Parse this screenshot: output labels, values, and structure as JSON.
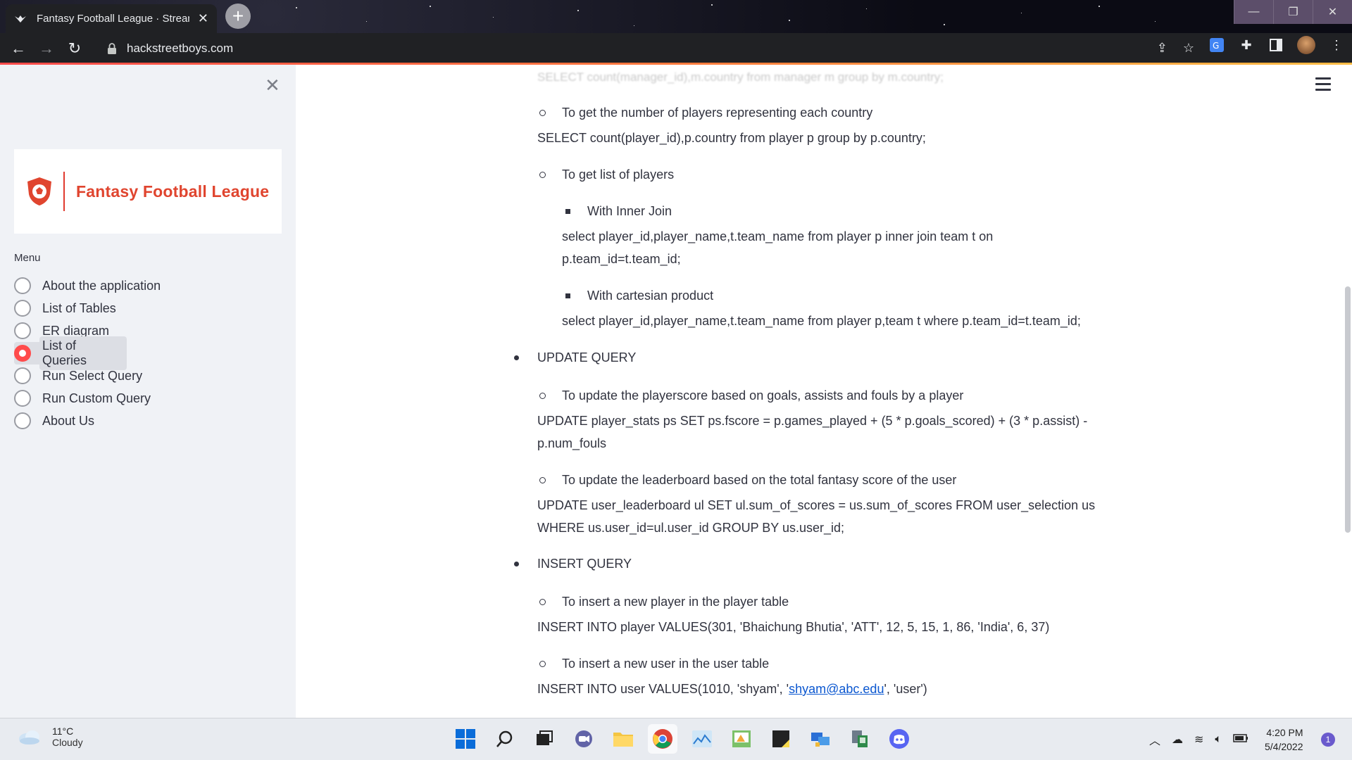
{
  "browser": {
    "tab_title": "Fantasy Football League · Stream",
    "tab_close": "✕",
    "new_tab": "+",
    "url": "hackstreetboys.com",
    "window_controls": {
      "minimize": "—",
      "restore": "❐",
      "close": "✕"
    }
  },
  "sidebar": {
    "close_symbol": "✕",
    "logo_text": "Fantasy Football League",
    "menu_label": "Menu",
    "items": [
      {
        "label": "About the application",
        "selected": false
      },
      {
        "label": "List of Tables",
        "selected": false
      },
      {
        "label": "ER diagram",
        "selected": false
      },
      {
        "label": "List of Queries",
        "selected": true
      },
      {
        "label": "Run Select Query",
        "selected": false
      },
      {
        "label": "Run Custom Query",
        "selected": false
      },
      {
        "label": "About Us",
        "selected": false
      }
    ]
  },
  "content": {
    "faded_top": "SELECT count(manager_id),m.country from manager m group by m.country;",
    "q_players_per_country": "To get the number of players representing each country",
    "sql_players_per_country": "SELECT count(player_id),p.country from player p group by p.country;",
    "q_list_players": "To get list of players",
    "q_inner_join": "With Inner Join",
    "sql_inner_join_1": "select player_id,player_name,t.team_name from player p inner join team t on",
    "sql_inner_join_2": "p.team_id=t.team_id;",
    "q_cartesian": "With cartesian product",
    "sql_cartesian": "select player_id,player_name,t.team_name from player p,team t where p.team_id=t.team_id;",
    "update_heading": "UPDATE QUERY",
    "q_update_score": "To update the playerscore based on goals, assists and fouls by a player",
    "sql_update_score_1": "UPDATE player_stats ps SET ps.fscore = p.games_played + (5 * p.goals_scored) + (3 * p.assist) -",
    "sql_update_score_2": "p.num_fouls",
    "q_update_leaderboard": "To update the leaderboard based on the total fantasy score of the user",
    "sql_update_leaderboard_1": "UPDATE user_leaderboard ul SET ul.sum_of_scores = us.sum_of_scores FROM user_selection us",
    "sql_update_leaderboard_2": "WHERE us.user_id=ul.user_id GROUP BY us.user_id;",
    "insert_heading": "INSERT QUERY",
    "q_insert_player": "To insert a new player in the player table",
    "sql_insert_player": "INSERT INTO player VALUES(301, 'Bhaichung Bhutia', 'ATT', 12, 5, 15, 1, 86, 'India', 6, 37)",
    "q_insert_user": "To insert a new user in the user table",
    "sql_insert_user_prefix": "INSERT INTO user VALUES(1010, 'shyam', '",
    "sql_insert_user_email": "shyam@abc.edu",
    "sql_insert_user_suffix": "', 'user')"
  },
  "taskbar": {
    "weather_temp": "11°C",
    "weather_desc": "Cloudy",
    "time": "4:20 PM",
    "date": "5/4/2022",
    "notification_count": "1"
  },
  "colors": {
    "accent": "#ff4b4b",
    "logo": "#e0452f",
    "sidebar_bg": "#f0f2f6",
    "link": "#0b57d0"
  }
}
